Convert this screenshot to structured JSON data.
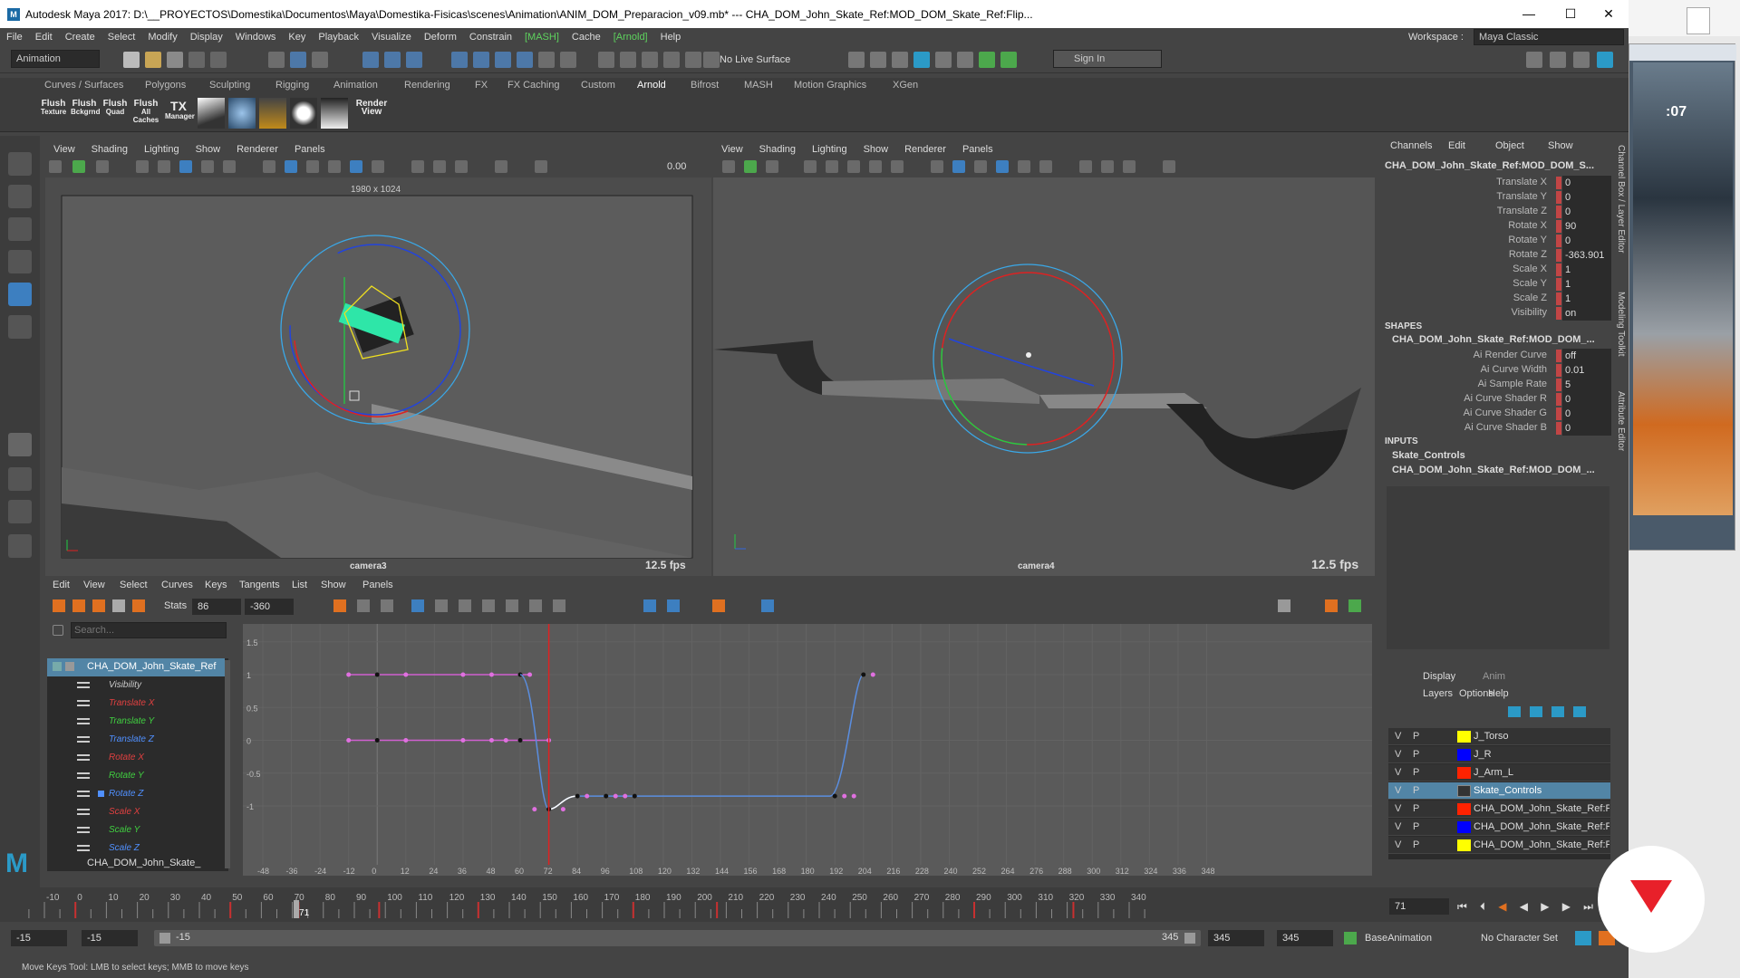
{
  "app": {
    "title": "Autodesk Maya 2017: D:\\__PROYECTOS\\Domestika\\Documentos\\Maya\\Domestika-Fisicas\\scenes\\Animation\\ANIM_DOM_Preparacion_v09.mb*   ---   CHA_DOM_John_Skate_Ref:MOD_DOM_Skate_Ref:Flip...",
    "icon_letter": "M",
    "minimize": "—",
    "maximize": "☐",
    "close": "✕"
  },
  "menubar": [
    "File",
    "Edit",
    "Create",
    "Select",
    "Modify",
    "Display",
    "Windows",
    "Key",
    "Playback",
    "Visualize",
    "Deform",
    "Constrain",
    "[MASH]",
    "Cache",
    "[Arnold]",
    "Help"
  ],
  "workspace": {
    "label": "Workspace :",
    "value": "Maya Classic"
  },
  "statusline": {
    "menuset": "Animation",
    "live_surface": "No Live Surface",
    "sign_in": "Sign In"
  },
  "shelf_tabs": [
    "Curves / Surfaces",
    "Polygons",
    "Sculpting",
    "Rigging",
    "Animation",
    "Rendering",
    "FX",
    "FX Caching",
    "Custom",
    "Arnold",
    "Bifrost",
    "MASH",
    "Motion Graphics",
    "XGen"
  ],
  "shelf_active": "Arnold",
  "shelf_buttons": [
    {
      "l1": "Flush",
      "l2": "Texture"
    },
    {
      "l1": "Flush",
      "l2": "Bckgrnd"
    },
    {
      "l1": "Flush",
      "l2": "Quad"
    },
    {
      "l1": "Flush",
      "l2": "All Caches"
    },
    {
      "l1": "TX",
      "l2": "Manager"
    }
  ],
  "render_view": {
    "l1": "Render",
    "l2": "View"
  },
  "panel_menu": [
    "View",
    "Shading",
    "Lighting",
    "Show",
    "Renderer",
    "Panels"
  ],
  "viewport_left": {
    "resolution": "1980 x 1024",
    "camera": "camera3",
    "fps": "12.5 fps",
    "near_clip": "0.00"
  },
  "viewport_right": {
    "camera": "camera4",
    "fps": "12.5 fps"
  },
  "channelbox": {
    "menu": [
      "Channels",
      "Edit",
      "Object",
      "Show"
    ],
    "object": "CHA_DOM_John_Skate_Ref:MOD_DOM_S...",
    "channels": [
      {
        "name": "Translate X",
        "value": "0"
      },
      {
        "name": "Translate Y",
        "value": "0"
      },
      {
        "name": "Translate Z",
        "value": "0"
      },
      {
        "name": "Rotate X",
        "value": "90"
      },
      {
        "name": "Rotate Y",
        "value": "0"
      },
      {
        "name": "Rotate Z",
        "value": "-363.901"
      },
      {
        "name": "Scale X",
        "value": "1"
      },
      {
        "name": "Scale Y",
        "value": "1"
      },
      {
        "name": "Scale Z",
        "value": "1"
      },
      {
        "name": "Visibility",
        "value": "on"
      }
    ],
    "shapes_label": "SHAPES",
    "shape_name": "CHA_DOM_John_Skate_Ref:MOD_DOM_...",
    "shape_attrs": [
      {
        "name": "Ai Render Curve",
        "value": "off"
      },
      {
        "name": "Ai Curve Width",
        "value": "0.01"
      },
      {
        "name": "Ai Sample Rate",
        "value": "5"
      },
      {
        "name": "Ai Curve Shader R",
        "value": "0"
      },
      {
        "name": "Ai Curve Shader G",
        "value": "0"
      },
      {
        "name": "Ai Curve Shader B",
        "value": "0"
      }
    ],
    "inputs_label": "INPUTS",
    "inputs": [
      "Skate_Controls",
      "CHA_DOM_John_Skate_Ref:MOD_DOM_..."
    ],
    "side_tabs": [
      "Channel Box / Layer Editor",
      "Modeling Toolkit",
      "Attribute Editor"
    ]
  },
  "layers": {
    "tabs": [
      "Display",
      "Anim"
    ],
    "menu": [
      "Layers",
      "Options",
      "Help"
    ],
    "rows": [
      {
        "v": "V",
        "p": "P",
        "name": "J_Torso",
        "color": "#ffff00"
      },
      {
        "v": "V",
        "p": "P",
        "name": "J_R",
        "color": "#0000ff"
      },
      {
        "v": "V",
        "p": "P",
        "name": "J_Arm_L",
        "color": "#ff2200"
      },
      {
        "v": "V",
        "p": "P",
        "name": "Skate_Controls",
        "color": "none",
        "selected": true
      },
      {
        "v": "V",
        "p": "P",
        "name": "CHA_DOM_John_Skate_Ref:Ri",
        "color": "#ff2200"
      },
      {
        "v": "V",
        "p": "P",
        "name": "CHA_DOM_John_Skate_Ref:Ri",
        "color": "#0000ff"
      },
      {
        "v": "V",
        "p": "P",
        "name": "CHA_DOM_John_Skate_Ref:Ri",
        "color": "#ffff00"
      }
    ]
  },
  "graph_editor": {
    "menu": [
      "Edit",
      "View",
      "Select",
      "Curves",
      "Keys",
      "Tangents",
      "List",
      "Show",
      "Panels"
    ],
    "stats_label": "Stats",
    "stats_frame": "86",
    "stats_value": "-360",
    "search_placeholder": "Search...",
    "outliner_root": "CHA_DOM_John_Skate_Ref",
    "outliner_root_2": "CHA_DOM_John_Skate_",
    "attributes": [
      {
        "name": "Visibility",
        "color": "#cccccc"
      },
      {
        "name": "Translate X",
        "color": "#e04040"
      },
      {
        "name": "Translate Y",
        "color": "#40d040"
      },
      {
        "name": "Translate Z",
        "color": "#5090ff"
      },
      {
        "name": "Rotate X",
        "color": "#e04040"
      },
      {
        "name": "Rotate Y",
        "color": "#40d040"
      },
      {
        "name": "Rotate Z",
        "color": "#5090ff"
      },
      {
        "name": "Scale X",
        "color": "#e04040"
      },
      {
        "name": "Scale Y",
        "color": "#40d040"
      },
      {
        "name": "Scale Z",
        "color": "#5090ff"
      }
    ],
    "y_ticks": [
      "1.5",
      "1",
      "0.5",
      "0",
      "-0.5",
      "-1"
    ],
    "x_ticks": [
      "-48",
      "-36",
      "-24",
      "-12",
      "0",
      "12",
      "24",
      "36",
      "48",
      "60",
      "72",
      "84",
      "96",
      "108",
      "120",
      "132",
      "144",
      "156",
      "168",
      "180",
      "192",
      "204",
      "216",
      "228",
      "240",
      "252",
      "264",
      "276",
      "288",
      "300",
      "312",
      "324",
      "336",
      "348"
    ],
    "current_frame_marker": "72"
  },
  "timeline": {
    "ticks": [
      "-10",
      "0",
      "10",
      "20",
      "30",
      "40",
      "50",
      "60",
      "70",
      "80",
      "90",
      "100",
      "110",
      "120",
      "130",
      "140",
      "150",
      "160",
      "170",
      "180",
      "190",
      "200",
      "210",
      "220",
      "230",
      "240",
      "250",
      "260",
      "270",
      "280",
      "290",
      "300",
      "310",
      "320",
      "330",
      "340"
    ],
    "current": "71",
    "current_field": "71"
  },
  "range": {
    "start": "-15",
    "anim_start": "-15",
    "slider_start": "-15",
    "slider_end": "345",
    "end": "345",
    "anim_end": "345",
    "layer": "BaseAnimation",
    "character": "No Character Set"
  },
  "help_line": "Move Keys Tool: LMB to select keys; MMB to move keys",
  "side_window": {
    "time": ":07"
  }
}
